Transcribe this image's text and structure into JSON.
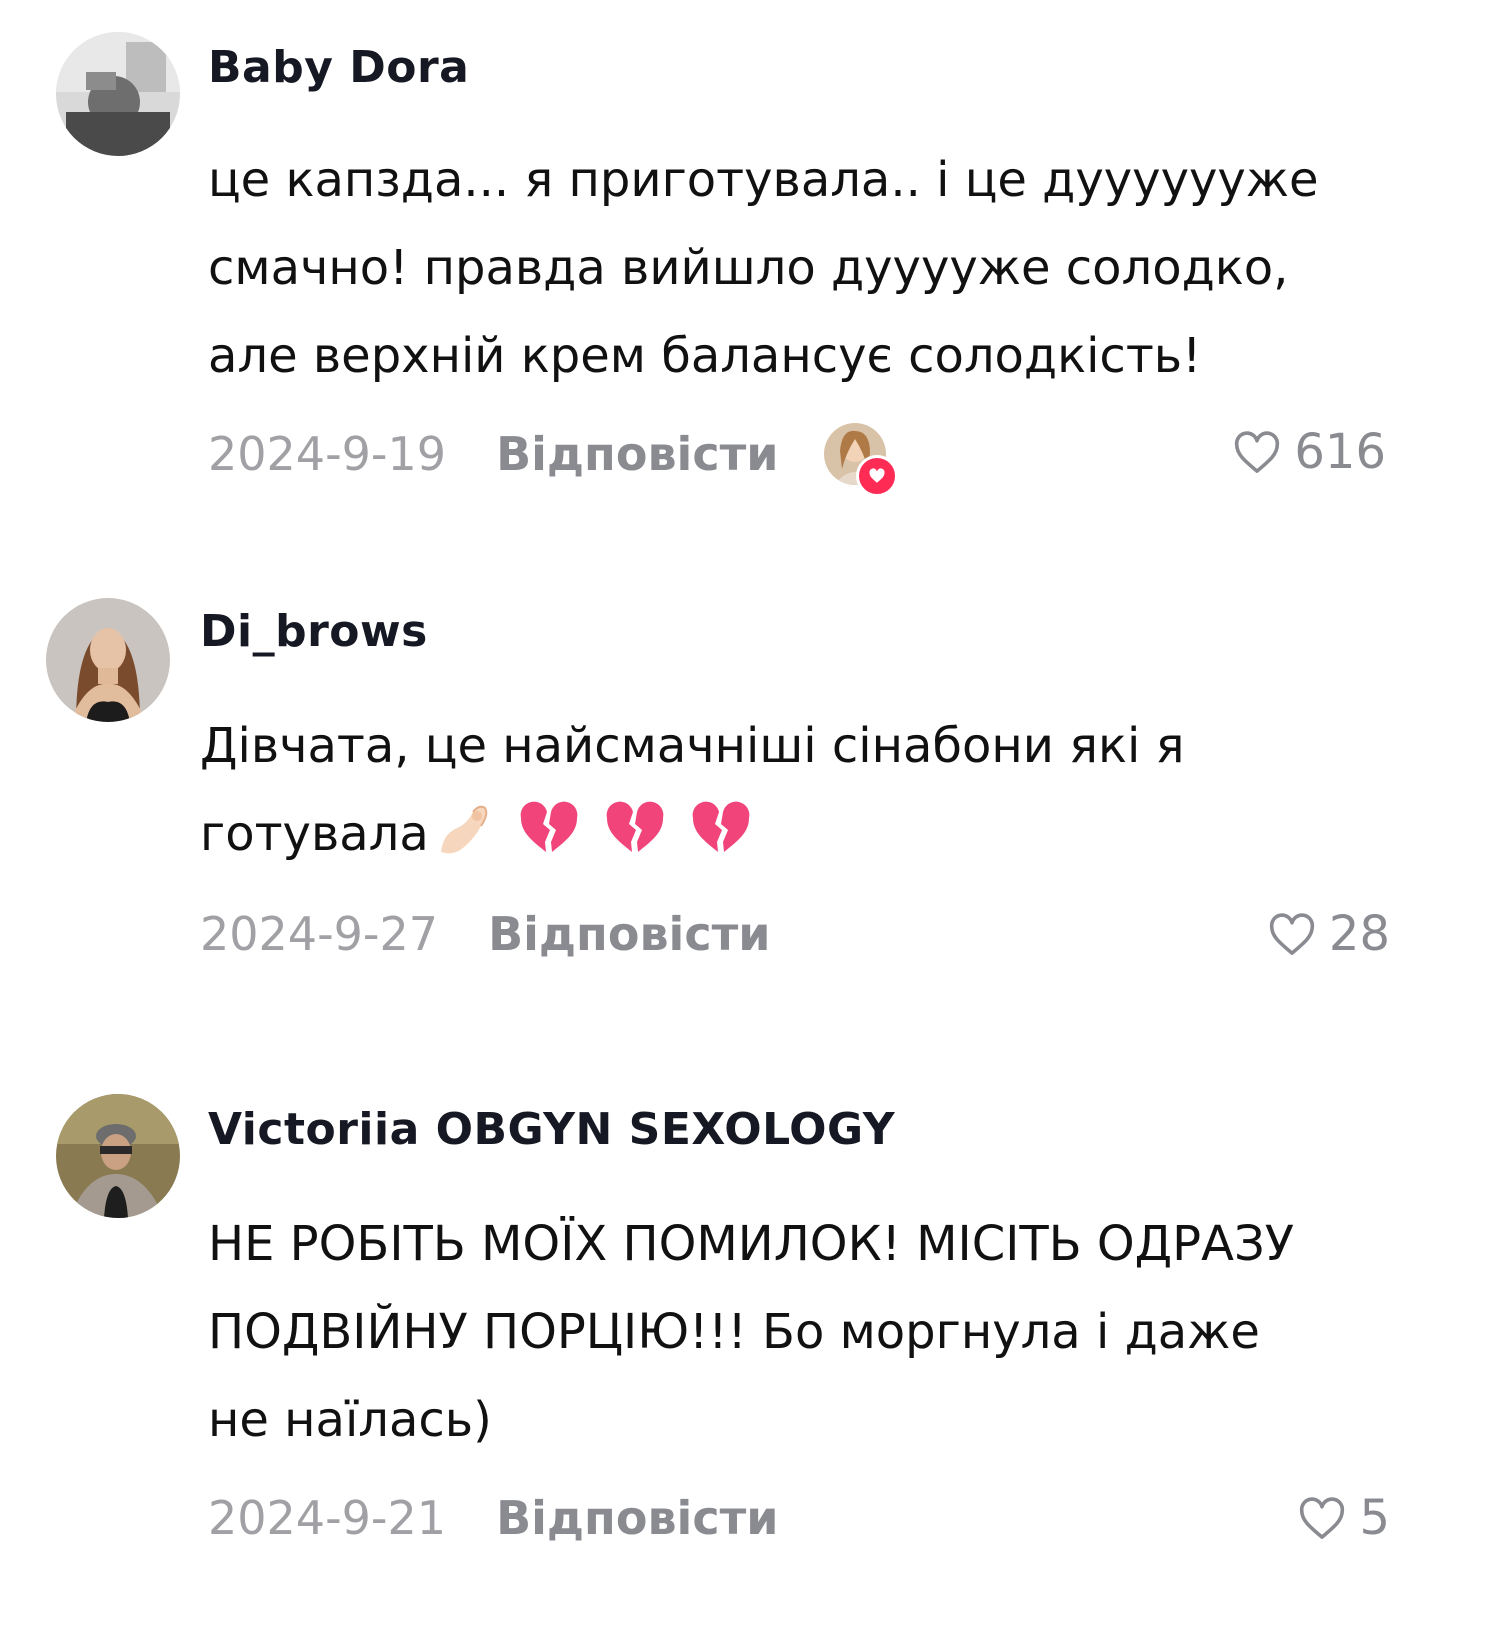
{
  "comments": [
    {
      "username": "Baby Dora",
      "text_lines": [
        "це капзда... я приготувала.. і це дууууууже",
        "смачно! правда вийшло дууууже солодко,",
        "але верхній крем балансує солодкість!"
      ],
      "date": "2024-9-19",
      "reply_label": "Відповісти",
      "likes": "616",
      "liked_by_creator": true
    },
    {
      "username": "Di_brows",
      "text_lines": [
        "Дівчата, це найсмачніші сінабони які я",
        "готувала"
      ],
      "emojis": [
        "pinched-fingers-emoji",
        "broken-heart-emoji",
        "broken-heart-emoji",
        "broken-heart-emoji"
      ],
      "date": "2024-9-27",
      "reply_label": "Відповісти",
      "likes": "28"
    },
    {
      "username": "Victoriia OBGYN SEXOLOGY",
      "text_lines": [
        "НЕ РОБІТЬ МОЇХ ПОМИЛОК! МІСІТЬ ОДРАЗУ",
        "ПОДВІЙНУ ПОРЦІЮ!!! Бо моргнула і даже",
        "не наїлась)"
      ],
      "date": "2024-9-21",
      "reply_label": "Відповісти",
      "likes": "5"
    }
  ],
  "colors": {
    "username": "#161823",
    "text": "#111111",
    "meta": "#a0a0a5",
    "reply": "#8a8b91",
    "creator_heart": "#fe2c55",
    "broken_heart": "#f0447a"
  }
}
